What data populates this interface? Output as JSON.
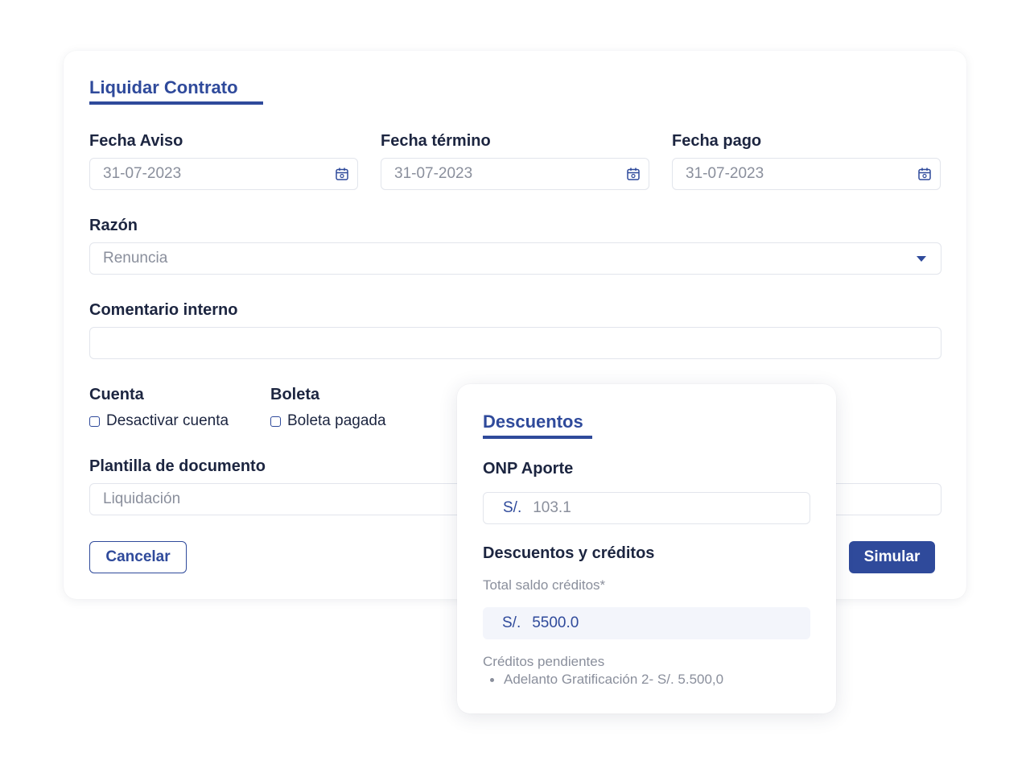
{
  "form": {
    "title": "Liquidar Contrato",
    "fecha_aviso": {
      "label": "Fecha Aviso",
      "value": "31-07-2023"
    },
    "fecha_termino": {
      "label": "Fecha término",
      "value": "31-07-2023"
    },
    "fecha_pago": {
      "label": "Fecha pago",
      "value": "31-07-2023"
    },
    "razon": {
      "label": "Razón",
      "value": "Renuncia"
    },
    "comentario": {
      "label": "Comentario interno",
      "value": ""
    },
    "cuenta": {
      "label": "Cuenta",
      "checkbox_label": "Desactivar cuenta",
      "checked": false
    },
    "boleta": {
      "label": "Boleta",
      "checkbox_label": "Boleta pagada",
      "checked": false
    },
    "plantilla": {
      "label": "Plantilla de documento",
      "value": "Liquidación"
    },
    "cancel_label": "Cancelar",
    "simulate_label": "Simular"
  },
  "descuentos": {
    "title": "Descuentos",
    "onp": {
      "label": "ONP Aporte",
      "currency": "S/.",
      "value": "103.1"
    },
    "section_label": "Descuentos y créditos",
    "total": {
      "label": "Total saldo créditos*",
      "currency": "S/.",
      "value": "5500.0"
    },
    "pending_label": "Créditos pendientes",
    "pending_items": [
      "Adelanto Gratificación 2- S/. 5.500,0"
    ]
  },
  "icons": {
    "date": "calendar-icon",
    "select": "chevron-down-icon"
  },
  "colors": {
    "accent": "#2f4a9b",
    "text": "#1c2540",
    "muted": "#8a8f9c",
    "border": "#e2e5ec"
  }
}
